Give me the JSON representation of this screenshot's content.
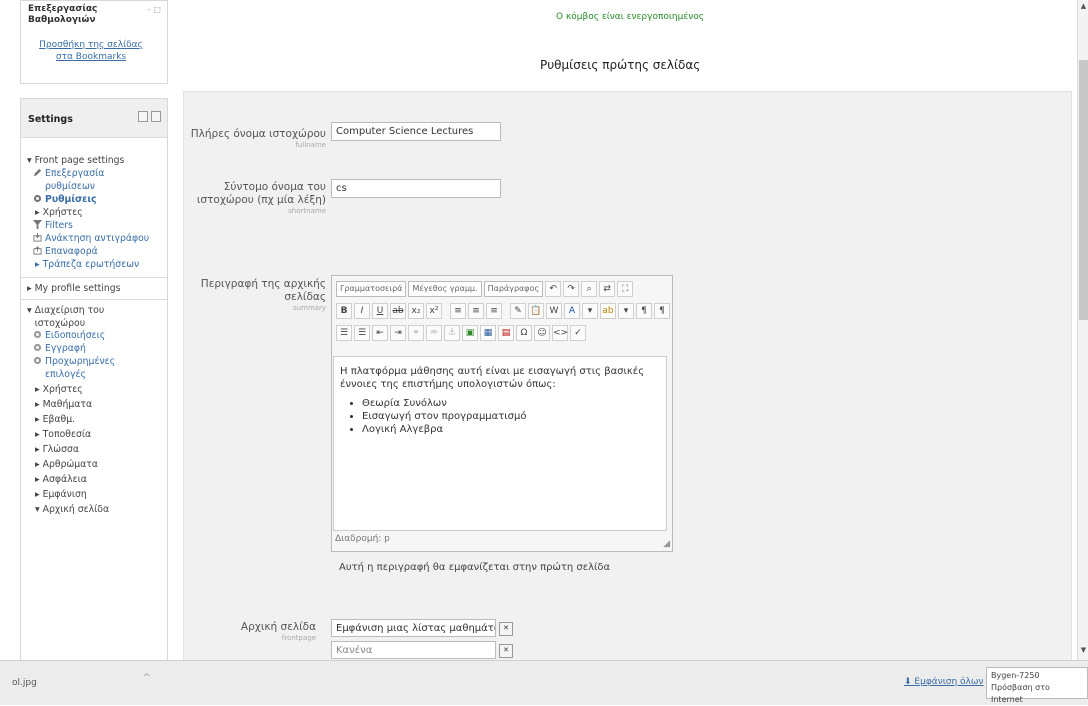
{
  "sidebar_top": {
    "title": "Επεξεργασίας Βαθμολογιών",
    "link": "Προσθήκη της σελίδας στα Bookmarks"
  },
  "settings": {
    "title": "Settings",
    "items": [
      {
        "label": "Front page settings",
        "kind": "plain"
      },
      {
        "label": "Επεξεργασία ρυθμίσεων",
        "kind": "link"
      },
      {
        "label": "Ρυθμίσεις",
        "kind": "bold"
      },
      {
        "label": "Χρήστες",
        "kind": "plain"
      },
      {
        "label": "Filters",
        "kind": "link"
      },
      {
        "label": "Ανάκτηση αντιγράφου",
        "kind": "link"
      },
      {
        "label": "Επαναφορά",
        "kind": "link"
      },
      {
        "label": "Τράπεζα ερωτήσεων",
        "kind": "link"
      },
      {
        "label": "My profile settings",
        "kind": "plain"
      },
      {
        "label": "Διαχείριση του ιστοχώρου",
        "kind": "plain"
      },
      {
        "label": "Ειδοποιήσεις",
        "kind": "link"
      },
      {
        "label": "Εγγραφή",
        "kind": "link"
      },
      {
        "label": "Προχωρημένες επιλογές",
        "kind": "link"
      },
      {
        "label": "Χρήστες",
        "kind": "plain"
      },
      {
        "label": "Μαθήματα",
        "kind": "plain"
      },
      {
        "label": "Εβαθμ.",
        "kind": "plain"
      },
      {
        "label": "Τοποθεσία",
        "kind": "plain"
      },
      {
        "label": "Γλώσσα",
        "kind": "plain"
      },
      {
        "label": "Αρθρώματα",
        "kind": "plain"
      },
      {
        "label": "Ασφάλεια",
        "kind": "plain"
      },
      {
        "label": "Εμφάνιση",
        "kind": "plain"
      },
      {
        "label": "Αρχική σελίδα",
        "kind": "plain"
      }
    ]
  },
  "main": {
    "top_link": "Ο κόμβος είναι ενεργοποιημένος",
    "heading": "Ρυθμίσεις πρώτης σελίδας",
    "fields": {
      "fullname_label": "Πλήρες όνομα ιστοχώρου",
      "fullname_sub": "fullname",
      "fullname_value": "Computer Science Lectures",
      "shortname_label": "Σύντομο όνομα του ιστοχώρου (πχ μία λέξη)",
      "shortname_sub": "shortname",
      "shortname_value": "cs",
      "summary_label": "Περιγραφή της αρχικής σελίδας",
      "summary_sub": "summary",
      "frontpage_label": "Αρχική σελίδα",
      "frontpage_sub": "frontpage",
      "frontpage_options": [
        "Εμφάνιση μιας λίστας μαθημάτων",
        "Κανένα"
      ]
    },
    "editor": {
      "font_family": "Γραμματοσειρά",
      "font_size": "Μέγεθος γραμμ.",
      "paragraph": "Παράγραφος",
      "intro": "Η πλατφόρμα μάθησης αυτή είναι με εισαγωγή στις βασικές έννοιες της επιστήμης υπολογιστών όπως:",
      "bullets": [
        "Θεωρία Συνόλων",
        "Εισαγωγή στον προγραμματισμό",
        "Λογική Αλγεβρα"
      ],
      "status": "Διαδρομή: p"
    },
    "help": "Αυτή η περιγραφή θα εμφανίζεται στην πρώτη σελίδα"
  },
  "statusbar": {
    "left": "ol.jpg",
    "mid": "^",
    "link": "Εμφάνιση όλων",
    "popup_line1": "Bygen-7250",
    "popup_line2": "Πρόσβαση στο Internet"
  }
}
